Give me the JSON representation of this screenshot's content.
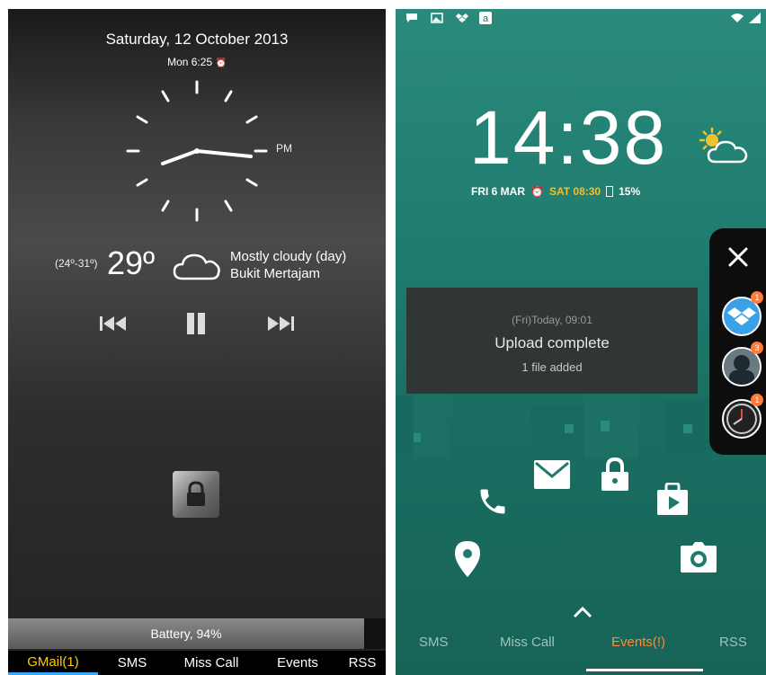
{
  "left_screen": {
    "date": "Saturday, 12 October 2013",
    "alarm": "Mon 6:25",
    "clock_period": "PM",
    "weather": {
      "range": "(24º-31º)",
      "temperature": "29º",
      "condition": "Mostly cloudy (day)",
      "location": "Bukit Mertajam"
    },
    "battery": "Battery, 94%",
    "tabs": [
      "GMail(1)",
      "SMS",
      "Miss Call",
      "Events",
      "RSS"
    ],
    "active_tab": "GMail(1)",
    "colors": {
      "active_tab_text": "#ffcc00",
      "active_tab_underline": "#33aaff"
    }
  },
  "right_screen": {
    "time": "14:38",
    "date": "FRI 6 MAR",
    "alarm": "SAT 08:30",
    "battery": "15%",
    "notification": {
      "timestamp": "(Fri)Today, 09:01",
      "title": "Upload complete",
      "detail": "1 file added"
    },
    "side_panel": {
      "badges": [
        "1",
        "3",
        "1"
      ]
    },
    "shortcuts": [
      "phone-icon",
      "mail-icon",
      "lock-icon",
      "play-store-icon",
      "location-icon",
      "camera-icon"
    ],
    "tabs": [
      "SMS",
      "Miss Call",
      "Events(!)",
      "RSS"
    ],
    "active_tab": "Events(!)",
    "colors": {
      "background": "#1e7a6d",
      "active_tab": "#ff8a3a",
      "alarm": "#f0c030"
    }
  }
}
